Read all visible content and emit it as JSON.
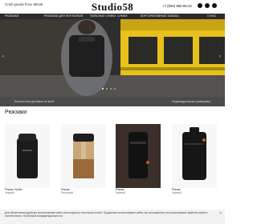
{
  "header": {
    "tagline": "Craft goods from Minsk",
    "brand": "Studio58",
    "phone": "+7 (909) 950-05-22",
    "social_icons": [
      "telegram-icon",
      "instagram-icon",
      "vk-icon"
    ]
  },
  "nav": {
    "items": [
      "РЮКЗАКИ",
      "РЮКЗАКИ ДЛЯ НОУТБУКОВ",
      "ПОЯСНЫЕ СУМКИ",
      "СУМКИ",
      "КОРПОРАТИВНЫЕ ЗАКАЗЫ",
      "О НАС"
    ]
  },
  "hero": {
    "slide_dots": 4
  },
  "subbar": {
    "left": "Бесплатная доставка по всей",
    "right": "Индивидуальная гравировка"
  },
  "section": {
    "title": "Рюкзаки"
  },
  "products": [
    {
      "name": "Рюкзак «Куба»",
      "color": "Черный"
    },
    {
      "name": "Рюкзак",
      "color": "Песочный"
    },
    {
      "name": "Рюкзак",
      "color": "Черный"
    },
    {
      "name": "Рюкзак",
      "color": "Черный"
    }
  ],
  "cookie": {
    "text": "Для обеспечения удобства использования сайта используются технологии cookie. Продолжая использование сайта, вы соглашаетесь на использование файлов cookie в соответствии с Политикой конфиденциальности"
  },
  "colors": {
    "navbar": "#2b2b2b",
    "subbar": "#4b4b4b",
    "hero_yellow": "#e7c21c"
  }
}
